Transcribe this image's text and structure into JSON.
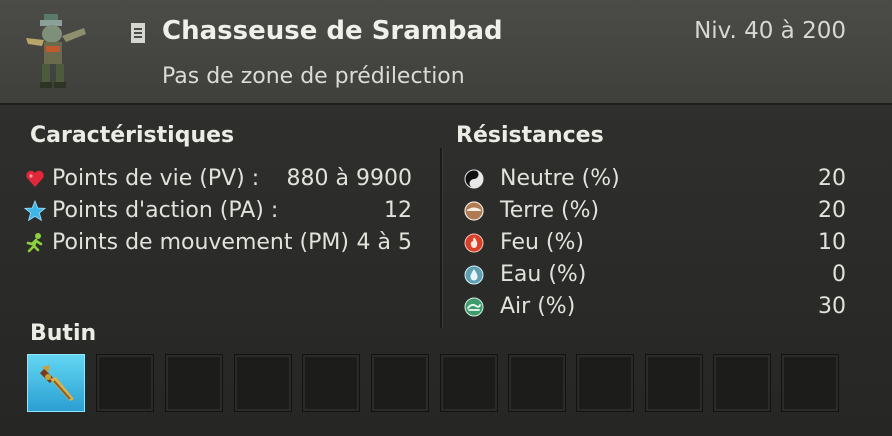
{
  "monster": {
    "name": "Chasseuse de Srambad",
    "level": "Niv. 40 à 200",
    "zone": "Pas de zone de prédilection"
  },
  "characteristics": {
    "title": "Caractéristiques",
    "rows": [
      {
        "icon": "heart-icon",
        "label": "Points de vie (PV) :",
        "value": "880 à 9900"
      },
      {
        "icon": "star-icon",
        "label": "Points d'action (PA) :",
        "value": "12"
      },
      {
        "icon": "running-man-icon",
        "label": "Points de mouvement (PM)",
        "value": "4 à 5"
      }
    ]
  },
  "resistances": {
    "title": "Résistances",
    "rows": [
      {
        "icon": "neutral-yin-yang-icon",
        "label": "Neutre (%)",
        "value": "20"
      },
      {
        "icon": "earth-icon",
        "label": "Terre (%)",
        "value": "20"
      },
      {
        "icon": "fire-icon",
        "label": "Feu (%)",
        "value": "10"
      },
      {
        "icon": "water-drop-icon",
        "label": "Eau (%)",
        "value": "0"
      },
      {
        "icon": "air-icon",
        "label": "Air (%)",
        "value": "30"
      }
    ]
  },
  "loot": {
    "title": "Butin",
    "slot_count": 12,
    "filled_slots": [
      {
        "index": 0,
        "icon": "dagger-icon"
      }
    ]
  },
  "colors": {
    "heart": "#e0283a",
    "star": "#3fb6e8",
    "movement": "#8cd23c",
    "fire": "#d8402a",
    "water": "#7fc7d8",
    "air": "#5fb88c",
    "earth": "#b07a52",
    "loot_slot_highlight": "#4ec3ea"
  }
}
